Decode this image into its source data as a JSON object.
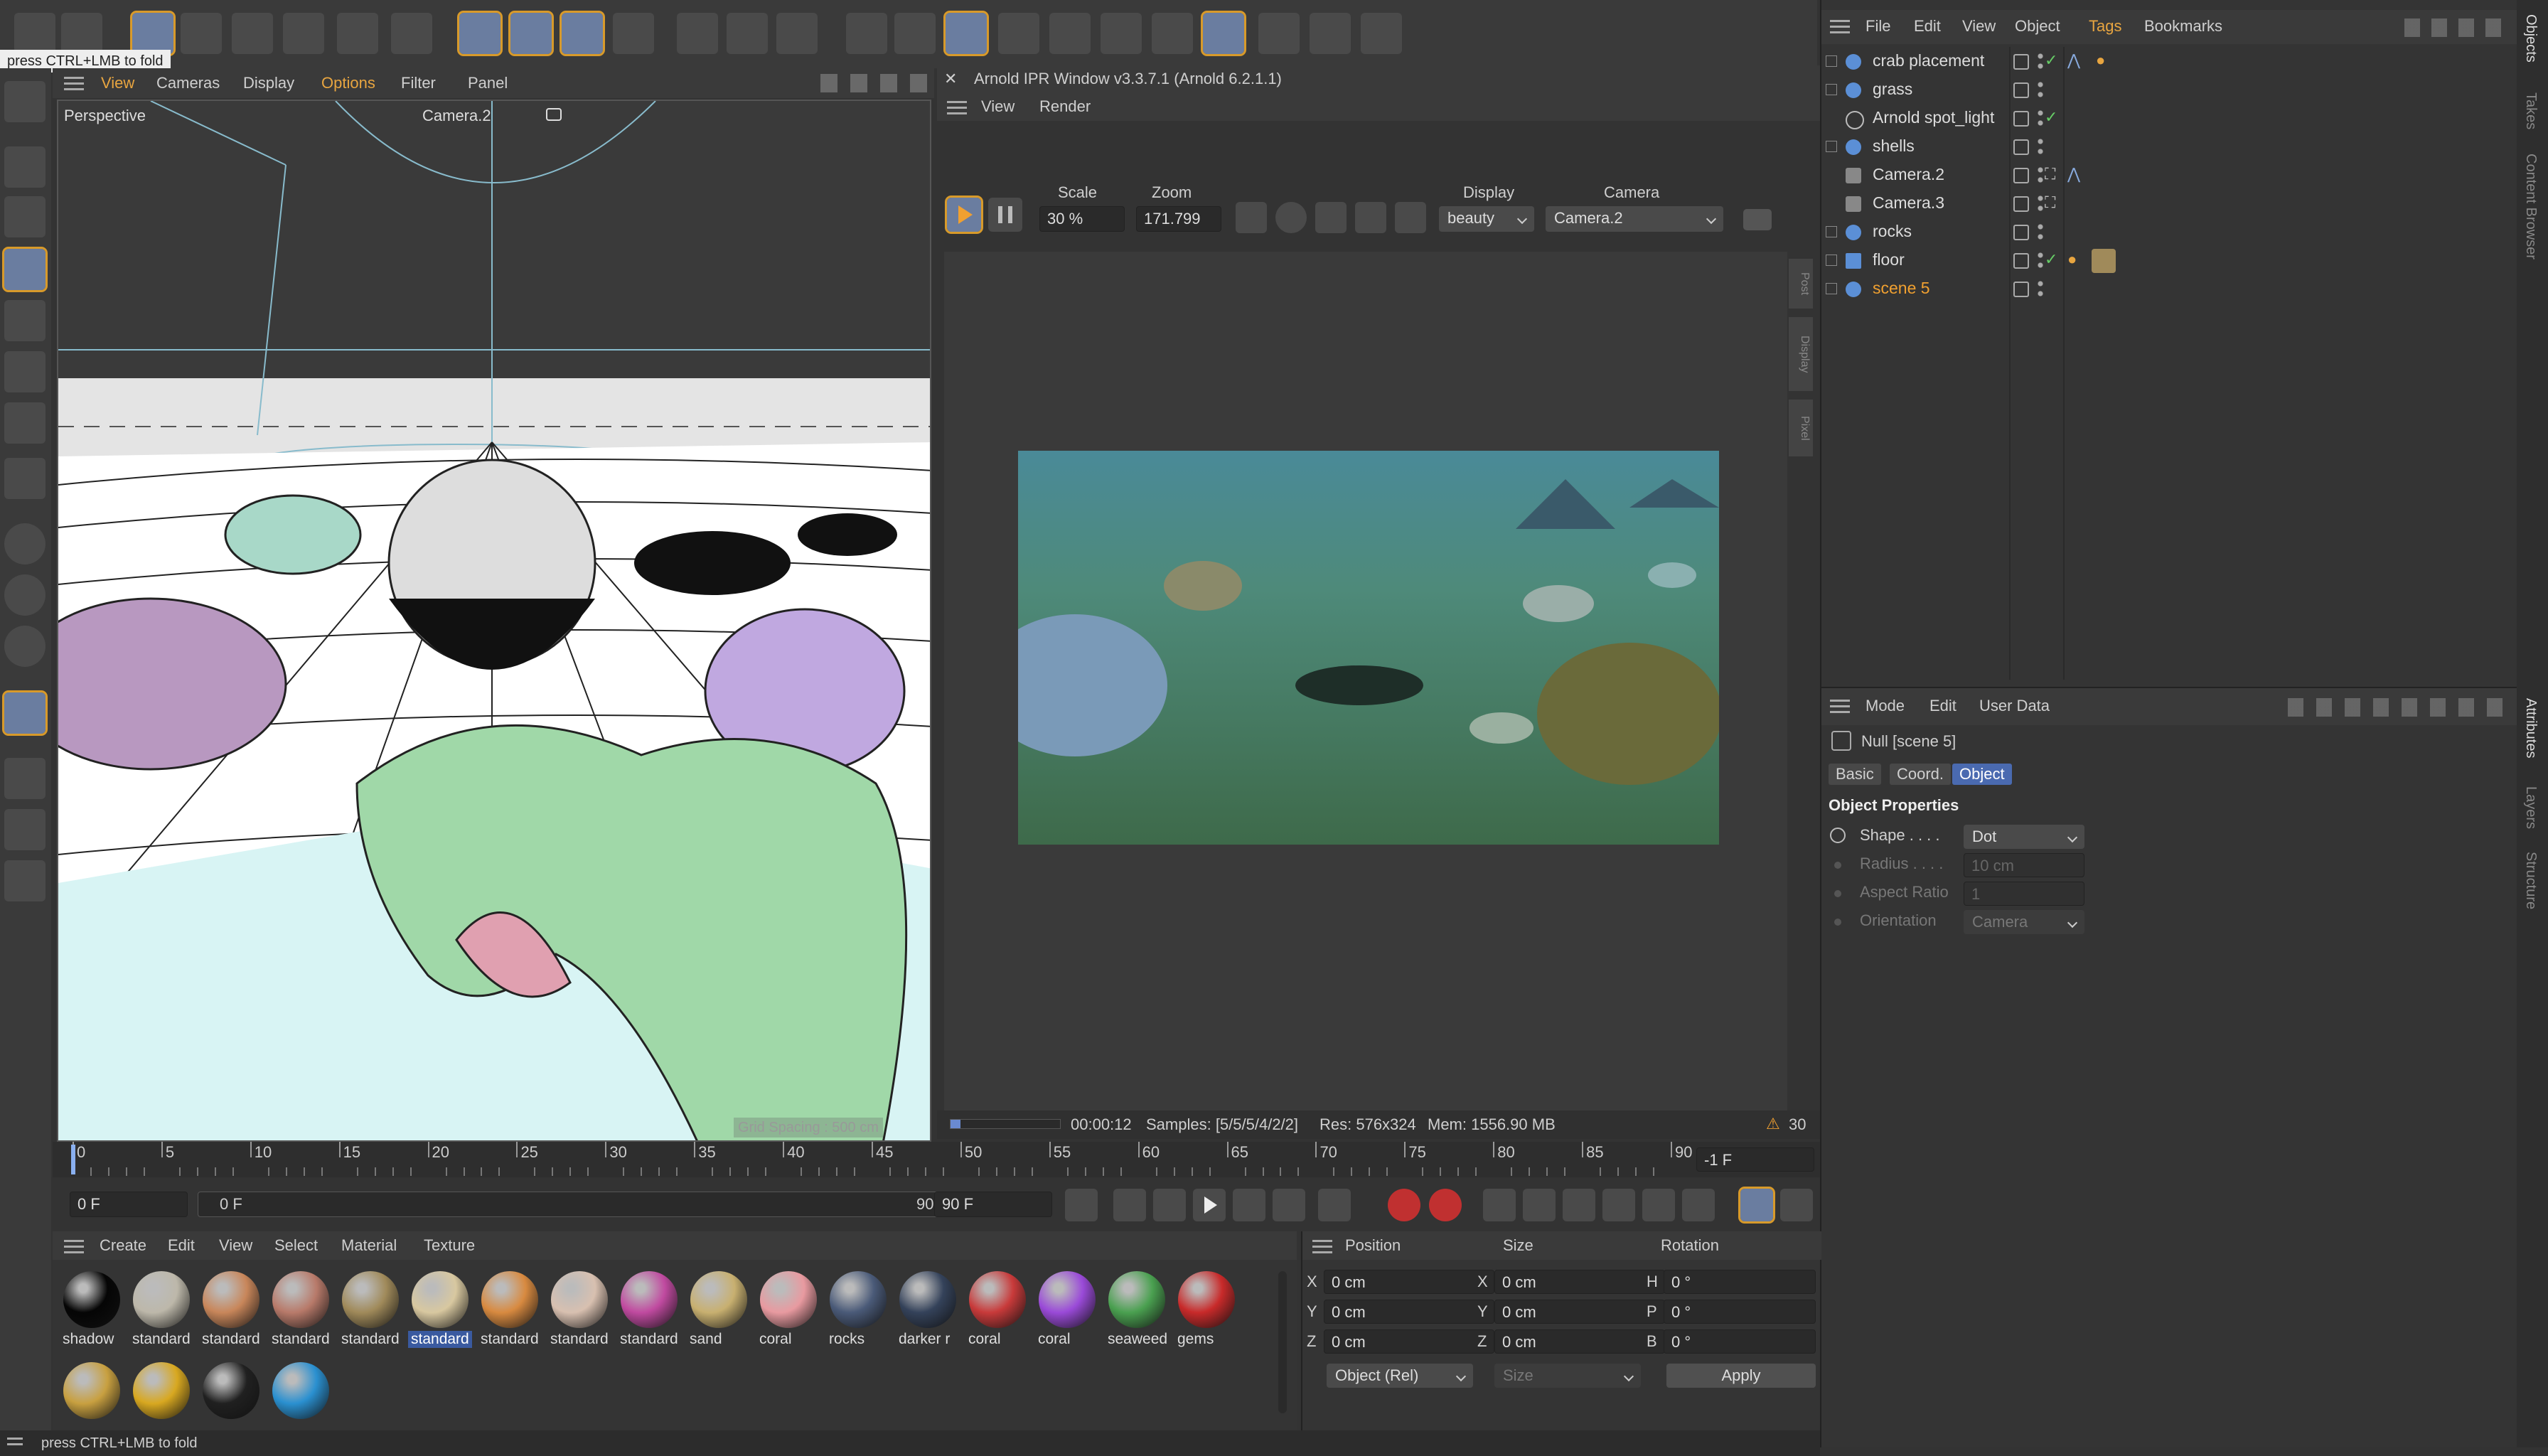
{
  "tooltip_top": "press CTRL+LMB to fold",
  "viewport": {
    "menu": [
      "View",
      "Cameras",
      "Display",
      "Options",
      "Filter",
      "Panel"
    ],
    "label_left": "Perspective",
    "label_cam": "Camera.2",
    "grid_spacing": "Grid Spacing : 500 cm"
  },
  "ipr": {
    "title": "Arnold IPR Window v3.3.7.1 (Arnold 6.2.1.1)",
    "menu": [
      "View",
      "Render"
    ],
    "scale_label": "Scale",
    "scale_value": "30 %",
    "zoom_label": "Zoom",
    "zoom_value": "171.799",
    "display_label": "Display",
    "display_value": "beauty",
    "camera_label": "Camera",
    "camera_value": "Camera.2",
    "side_tabs": [
      "Post",
      "Display",
      "Pixel"
    ],
    "status": {
      "time": "00:00:12",
      "samples": "Samples: [5/5/5/4/2/2]",
      "res": "Res: 576x324",
      "mem": "Mem: 1556.90 MB",
      "warnings": "30"
    }
  },
  "objects": {
    "menu": [
      "File",
      "Edit",
      "View",
      "Object",
      "Tags",
      "Bookmarks"
    ],
    "rows": [
      {
        "name": "crab placement"
      },
      {
        "name": "grass"
      },
      {
        "name": "Arnold spot_light"
      },
      {
        "name": "shells"
      },
      {
        "name": "Camera.2"
      },
      {
        "name": "Camera.3"
      },
      {
        "name": "rocks"
      },
      {
        "name": "floor"
      },
      {
        "name": "scene 5"
      }
    ],
    "right_tabs": [
      "Objects",
      "Takes",
      "Content Browser"
    ]
  },
  "attributes": {
    "menu": [
      "Mode",
      "Edit",
      "User Data"
    ],
    "title": "Null [scene 5]",
    "tabs": [
      "Basic",
      "Coord.",
      "Object"
    ],
    "section": "Object Properties",
    "props": [
      {
        "label": "Shape . . . .",
        "value": "Dot"
      },
      {
        "label": "Radius . . . .",
        "value": "10 cm"
      },
      {
        "label": "Aspect Ratio",
        "value": "1"
      },
      {
        "label": "Orientation",
        "value": "Camera"
      }
    ],
    "right_tabs": [
      "Attributes",
      "Layers",
      "Structure"
    ]
  },
  "timeline": {
    "ticks": [
      "0",
      "5",
      "10",
      "15",
      "20",
      "25",
      "30",
      "35",
      "40",
      "45",
      "50",
      "55",
      "60",
      "65",
      "70",
      "75",
      "80",
      "85",
      "90"
    ],
    "current_frame": "-1 F",
    "start": "0 F",
    "range_start": "0 F",
    "range_end": "90 F",
    "end": "90 F"
  },
  "materials": {
    "menu": [
      "Create",
      "Edit",
      "View",
      "Select",
      "Material",
      "Texture"
    ],
    "items": [
      {
        "name": "shadow",
        "color": "#050505"
      },
      {
        "name": "standard",
        "color": "#bdb8aa"
      },
      {
        "name": "standard",
        "color": "#c8865a"
      },
      {
        "name": "standard",
        "color": "#b87a6a"
      },
      {
        "name": "standard",
        "color": "#a08a5a"
      },
      {
        "name": "standard",
        "color": "#d8c8a0"
      },
      {
        "name": "standard",
        "color": "#d88a40"
      },
      {
        "name": "standard",
        "color": "#d8c0b0"
      },
      {
        "name": "standard",
        "color": "#c04aa0"
      },
      {
        "name": "sand",
        "color": "#c8b070"
      },
      {
        "name": "coral",
        "color": "#e89aa0"
      },
      {
        "name": "rocks",
        "color": "#4a5a78"
      },
      {
        "name": "darker r",
        "color": "#34425a"
      },
      {
        "name": "coral",
        "color": "#c83a3a"
      },
      {
        "name": "coral",
        "color": "#9a4ad8"
      },
      {
        "name": "seaweed",
        "color": "#4aa050"
      },
      {
        "name": "gems",
        "color": "#c82a2a"
      },
      {
        "name": "",
        "color": "#c8a040"
      },
      {
        "name": "",
        "color": "#d8a820"
      },
      {
        "name": "",
        "color": "#202020"
      },
      {
        "name": "",
        "color": "#2a90d0"
      }
    ]
  },
  "coords": {
    "headers": [
      "Position",
      "Size",
      "Rotation"
    ],
    "rows": [
      {
        "axis": "X",
        "pos": "0 cm",
        "saxis": "X",
        "size": "0 cm",
        "raxis": "H",
        "rot": "0 °"
      },
      {
        "axis": "Y",
        "pos": "0 cm",
        "saxis": "Y",
        "size": "0 cm",
        "raxis": "P",
        "rot": "0 °"
      },
      {
        "axis": "Z",
        "pos": "0 cm",
        "saxis": "Z",
        "size": "0 cm",
        "raxis": "B",
        "rot": "0 °"
      }
    ],
    "mode": "Object (Rel)",
    "size_mode": "Size",
    "apply": "Apply"
  },
  "status_bar": "press CTRL+LMB to fold"
}
